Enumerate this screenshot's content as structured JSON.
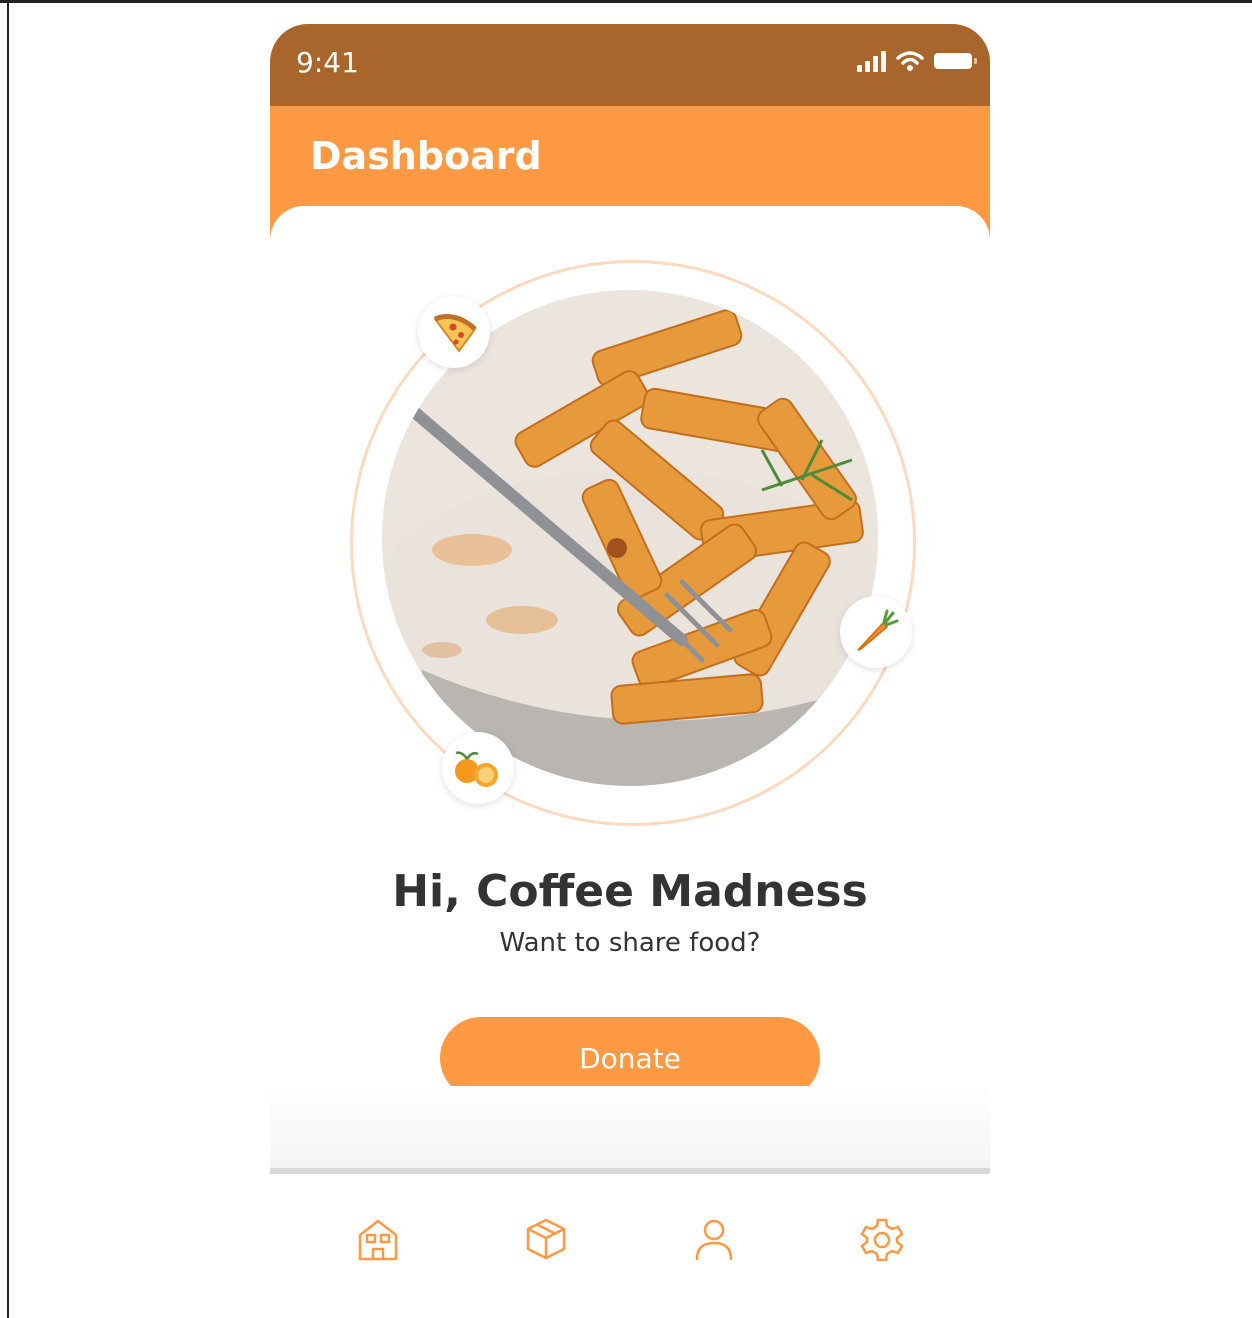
{
  "status_bar": {
    "time": "9:41"
  },
  "header": {
    "title": "Dashboard"
  },
  "hero": {
    "photo_icon": "pasta-plate-image",
    "badges": [
      "pizza-icon",
      "carrot-icon",
      "orange-icon"
    ]
  },
  "greeting": {
    "title": "Hi, Coffee Madness",
    "subtitle": "Want to share food?"
  },
  "actions": {
    "donate_label": "Donate"
  },
  "bottom_nav": {
    "items": [
      "home-icon",
      "box-icon",
      "user-icon",
      "settings-icon"
    ]
  },
  "colors": {
    "status_bar": "#a8662d",
    "accent": "#ff9944",
    "ring": "#fcd9bf",
    "text_dark": "#333333"
  }
}
